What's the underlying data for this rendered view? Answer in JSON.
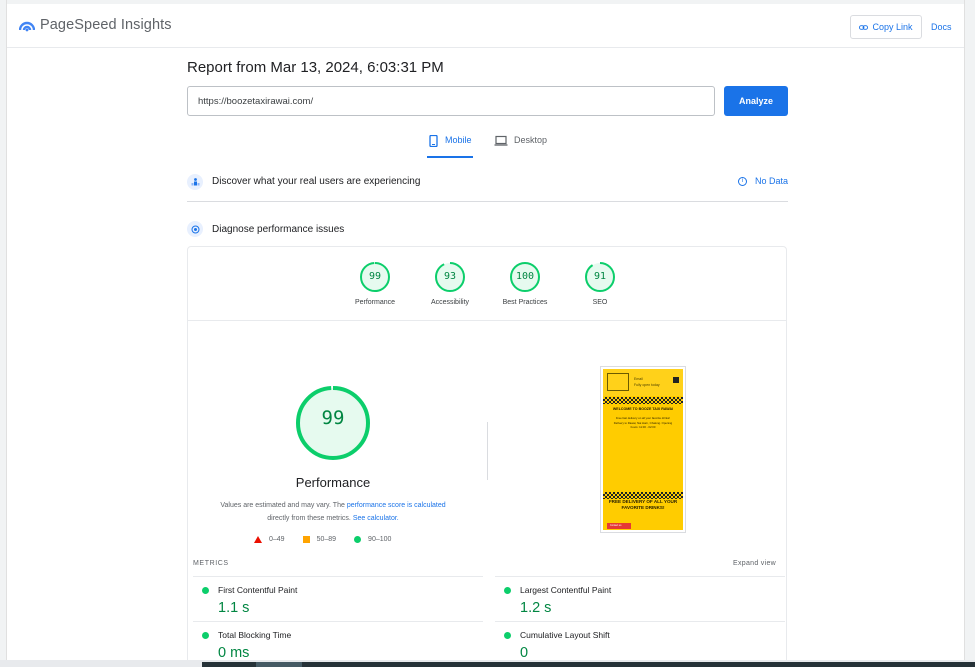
{
  "header": {
    "brand": "PageSpeed Insights",
    "copy_link": "Copy Link",
    "docs": "Docs"
  },
  "report": {
    "title": "Report from Mar 13, 2024, 6:03:31 PM",
    "url": "https://boozetaxirawai.com/",
    "analyze": "Analyze"
  },
  "tabs": {
    "mobile": "Mobile",
    "desktop": "Desktop",
    "selected": "Mobile"
  },
  "sections": {
    "discover": "Discover what your real users are experiencing",
    "no_data": "No Data",
    "diagnose": "Diagnose performance issues"
  },
  "scores": [
    {
      "label": "Performance",
      "value": "99"
    },
    {
      "label": "Accessibility",
      "value": "93"
    },
    {
      "label": "Best Practices",
      "value": "100"
    },
    {
      "label": "SEO",
      "value": "91"
    }
  ],
  "performance": {
    "score": "99",
    "title": "Performance",
    "note_prefix": "Values are estimated and may vary. The ",
    "note_link1": "performance score is calculated",
    "note_mid": " directly from these metrics. ",
    "note_link2": "See calculator.",
    "legend": {
      "fail": "0–49",
      "average": "50–89",
      "pass": "90–100"
    }
  },
  "thumbnail": {
    "small1": "Email",
    "small2": "Fully open today",
    "heading": "WELCOME TO BOOZE TAXI RAWAI",
    "body": "Free fast delivery on all your favorite drinks! Delivery to Rawai, Nai Harn, Chalong. Opening hours: 11:00 - 02:00",
    "banner": "FREE DELIVERY OF ALL YOUR FAVORITE DRINKS!",
    "button": "Contact us"
  },
  "metrics": {
    "label": "METRICS",
    "expand": "Expand view",
    "fcp": {
      "name": "First Contentful Paint",
      "value": "1.1 s"
    },
    "lcp": {
      "name": "Largest Contentful Paint",
      "value": "1.2 s"
    },
    "tbt": {
      "name": "Total Blocking Time",
      "value": "0 ms"
    },
    "cls": {
      "name": "Cumulative Layout Shift",
      "value": "0"
    }
  },
  "colors": {
    "accent": "#1a73e8",
    "pass": "#0cce6b",
    "pass_text": "#018642",
    "average": "#ffa400",
    "fail": "#eb0f00"
  }
}
